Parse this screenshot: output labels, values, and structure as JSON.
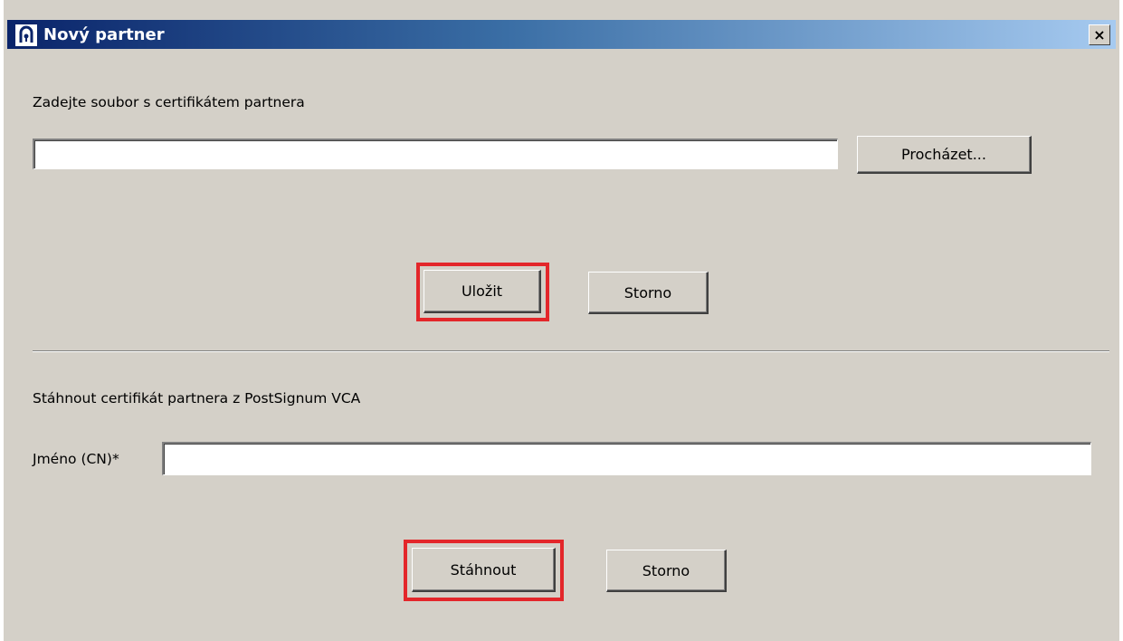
{
  "dialog": {
    "title": "Nový partner",
    "close_label": "×",
    "close_icon": "close-icon",
    "app_icon": "certificate-app-icon"
  },
  "section_file": {
    "label": "Zadejte soubor s certifikátem partnera",
    "file_input": {
      "value": "",
      "placeholder": ""
    },
    "browse_label": "Procházet...",
    "save_label": "Uložit",
    "cancel_label": "Storno"
  },
  "section_download": {
    "label": "Stáhnout certifikát partnera z PostSignum VCA",
    "name_label": "Jméno (CN)*",
    "name_input": {
      "value": "",
      "placeholder": ""
    },
    "download_label": "Stáhnout",
    "cancel_label": "Storno"
  },
  "colors": {
    "highlight": "#e3262a",
    "titlebar_start": "#0a246a",
    "titlebar_end": "#a6caf0",
    "window_bg": "#d4d0c8"
  }
}
